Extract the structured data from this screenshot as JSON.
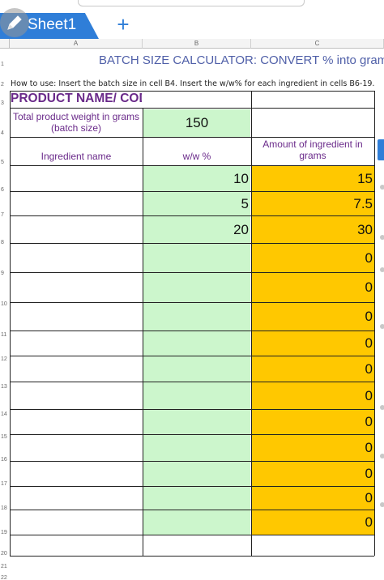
{
  "tabs": {
    "sheet_name": "Sheet1",
    "add_tab": "+"
  },
  "columns": [
    "A",
    "B",
    "C"
  ],
  "rows": [
    "1",
    "2",
    "3",
    "4",
    "5",
    "6",
    "7",
    "8",
    "9",
    "10",
    "11",
    "12",
    "13",
    "14",
    "15",
    "16",
    "17",
    "18",
    "19",
    "20",
    "21",
    "22"
  ],
  "title": "BATCH SIZE CALCULATOR: CONVERT %  into gram",
  "how_to": "How to use: Insert the batch size in cell B4. Insert the w/w% for each ingredient in cells B6-19.",
  "product_name": "PRODUCT NAME/ CODE",
  "total_weight_label": "Total product weight in grams (batch size)",
  "batch_size": "150",
  "ingredient_header": "Ingredient name",
  "ww_header": "w/w %",
  "amount_header": "Amount of ingredient in grams",
  "ingredients": [
    {
      "ww": "10",
      "amount": "15"
    },
    {
      "ww": "5",
      "amount": "7.5"
    },
    {
      "ww": "20",
      "amount": "30"
    },
    {
      "ww": "",
      "amount": "0"
    },
    {
      "ww": "",
      "amount": "0"
    },
    {
      "ww": "",
      "amount": "0"
    },
    {
      "ww": "",
      "amount": "0"
    },
    {
      "ww": "",
      "amount": "0"
    },
    {
      "ww": "",
      "amount": "0"
    },
    {
      "ww": "",
      "amount": "0"
    },
    {
      "ww": "",
      "amount": "0"
    },
    {
      "ww": "",
      "amount": "0"
    },
    {
      "ww": "",
      "amount": "0"
    },
    {
      "ww": "",
      "amount": "0"
    }
  ],
  "colors": {
    "accent": "#2f7ed8",
    "green_cell": "#ccf6cc",
    "orange_cell": "#ffc800",
    "header_text": "#6a2a8a",
    "title_text": "#4f5fa8"
  }
}
